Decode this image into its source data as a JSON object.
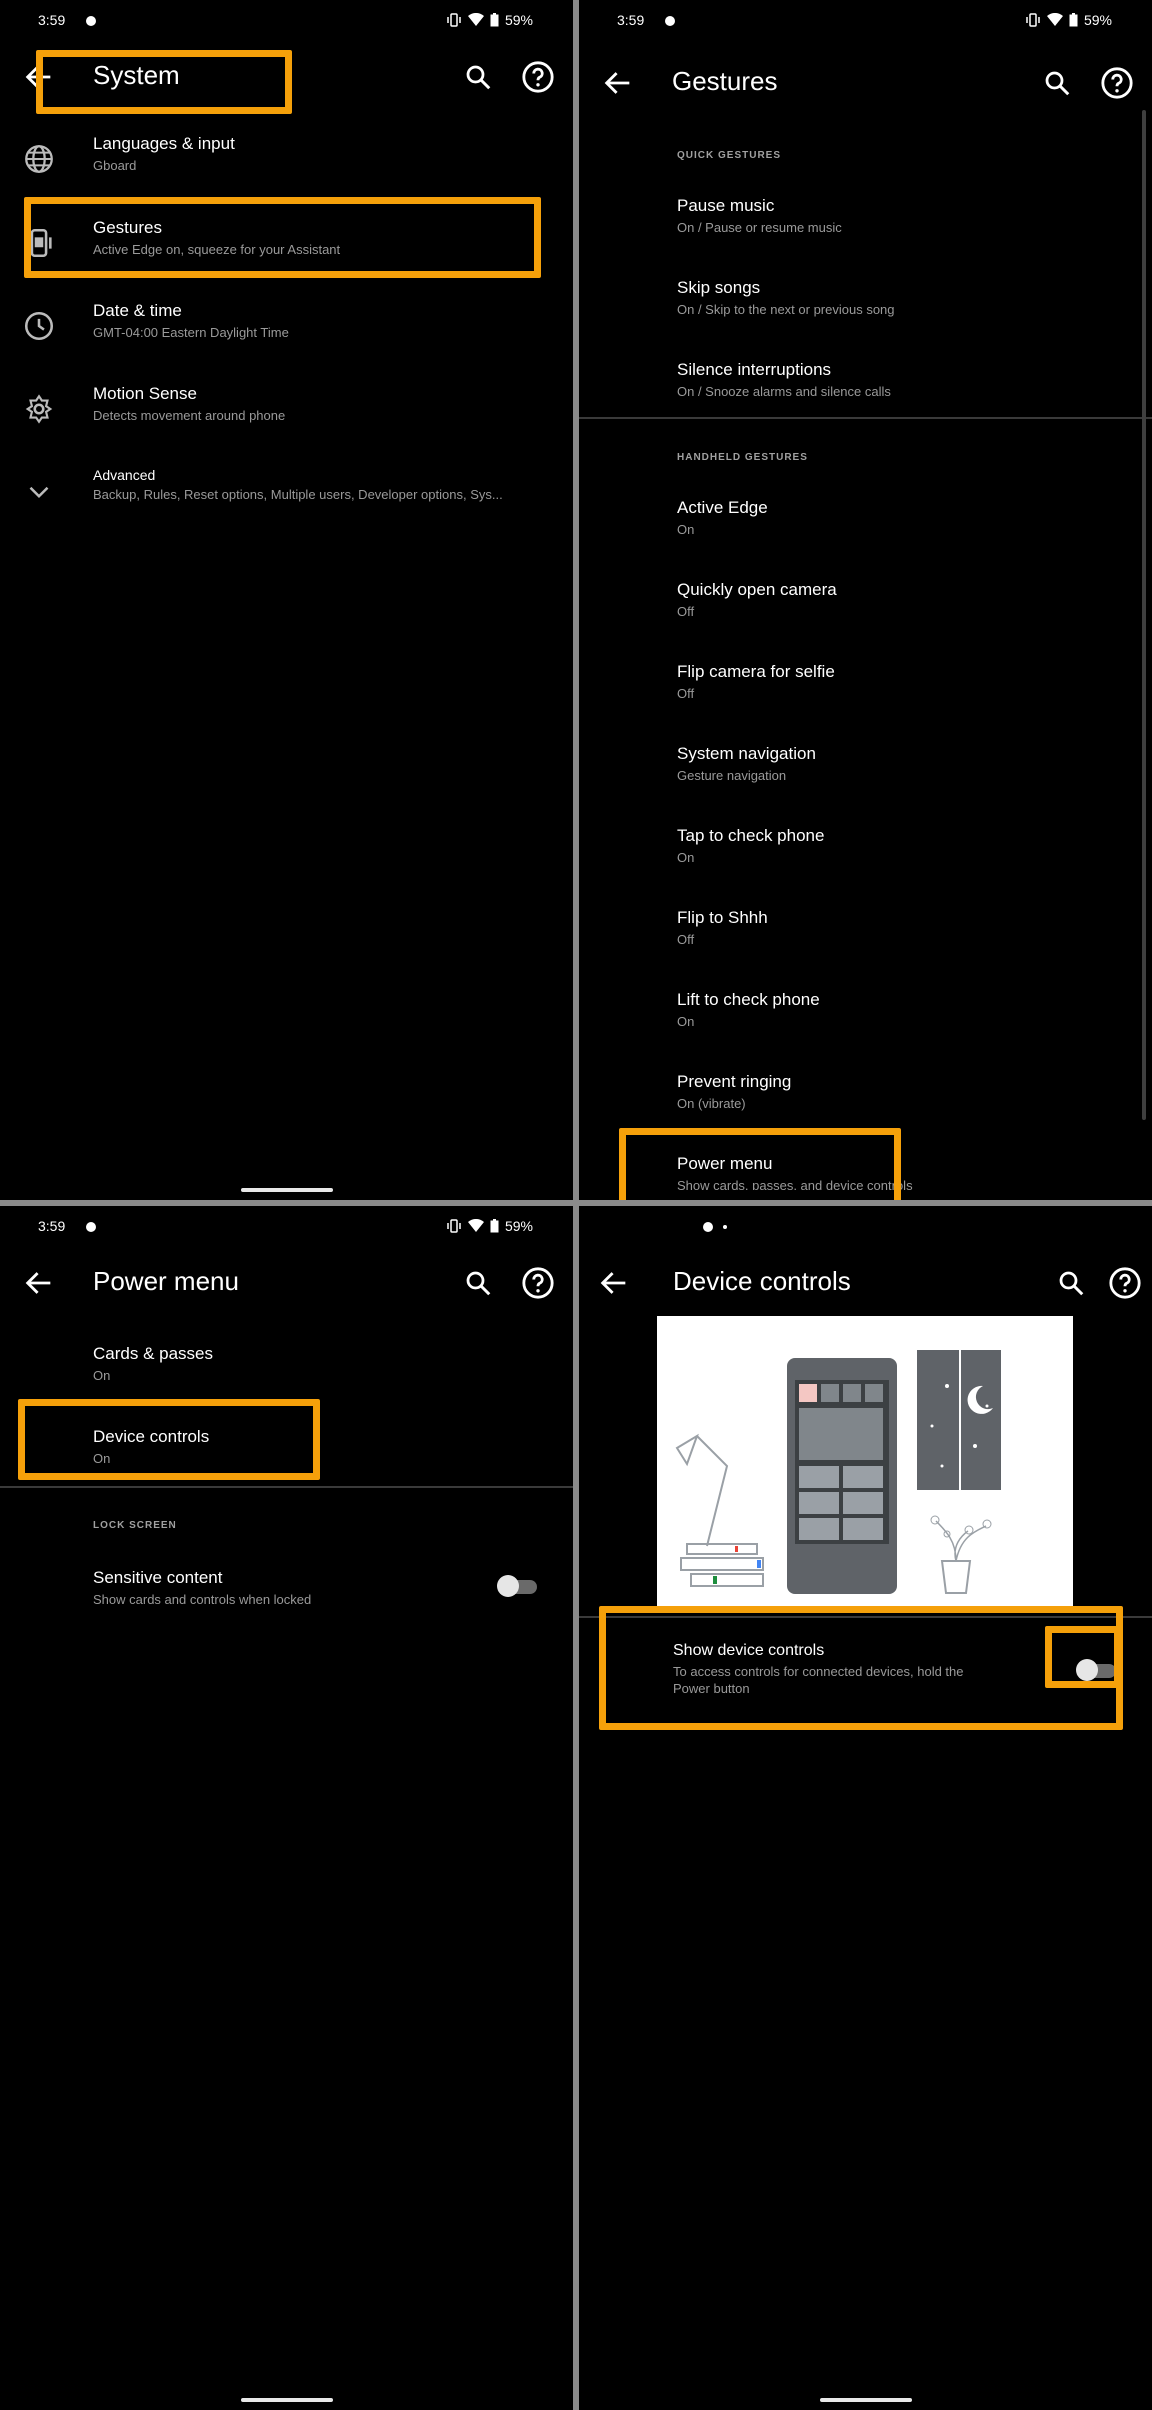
{
  "status_bar": {
    "time": "3:59",
    "battery": "59%"
  },
  "panel1": {
    "title": "System",
    "items": [
      {
        "title": "Languages & input",
        "subtitle": "Gboard",
        "icon": "globe-icon"
      },
      {
        "title": "Gestures",
        "subtitle": "Active Edge on, squeeze for your Assistant",
        "icon": "gestures-phone-icon"
      },
      {
        "title": "Date & time",
        "subtitle": "GMT-04:00 Eastern Daylight Time",
        "icon": "clock-icon"
      },
      {
        "title": "Motion Sense",
        "subtitle": "Detects movement around phone",
        "icon": "motion-sense-icon"
      },
      {
        "title": "Advanced",
        "subtitle": "Backup, Rules, Reset options, Multiple users, Developer options, Sys...",
        "icon": "chevron-down-icon"
      }
    ]
  },
  "panel2": {
    "title": "Gestures",
    "section_quick": "QUICK GESTURES",
    "quick_items": [
      {
        "title": "Pause music",
        "subtitle": "On / Pause or resume music"
      },
      {
        "title": "Skip songs",
        "subtitle": "On / Skip to the next or previous song"
      },
      {
        "title": "Silence interruptions",
        "subtitle": "On / Snooze alarms and silence calls"
      }
    ],
    "section_handheld": "HANDHELD GESTURES",
    "handheld_items": [
      {
        "title": "Active Edge",
        "subtitle": "On"
      },
      {
        "title": "Quickly open camera",
        "subtitle": "Off"
      },
      {
        "title": "Flip camera for selfie",
        "subtitle": "Off"
      },
      {
        "title": "System navigation",
        "subtitle": "Gesture navigation"
      },
      {
        "title": "Tap to check phone",
        "subtitle": "On"
      },
      {
        "title": "Flip to Shhh",
        "subtitle": "Off"
      },
      {
        "title": "Lift to check phone",
        "subtitle": "On"
      },
      {
        "title": "Prevent ringing",
        "subtitle": "On (vibrate)"
      },
      {
        "title": "Power menu",
        "subtitle": "Show cards, passes, and device controls"
      }
    ]
  },
  "panel3": {
    "title": "Power menu",
    "items": [
      {
        "title": "Cards & passes",
        "subtitle": "On"
      },
      {
        "title": "Device controls",
        "subtitle": "On"
      }
    ],
    "section_lock": "LOCK SCREEN",
    "sensitive": {
      "title": "Sensitive content",
      "subtitle": "Show cards and controls when locked",
      "toggle_on": false
    }
  },
  "panel4": {
    "title": "Device controls",
    "show": {
      "title": "Show device controls",
      "subtitle_line1": "To access controls for connected devices, hold the",
      "subtitle_line2": "Power button",
      "toggle_on": false
    }
  },
  "colors": {
    "highlight": "#f5a00a",
    "background": "#000000",
    "secondary_text": "#9a9a9a"
  }
}
